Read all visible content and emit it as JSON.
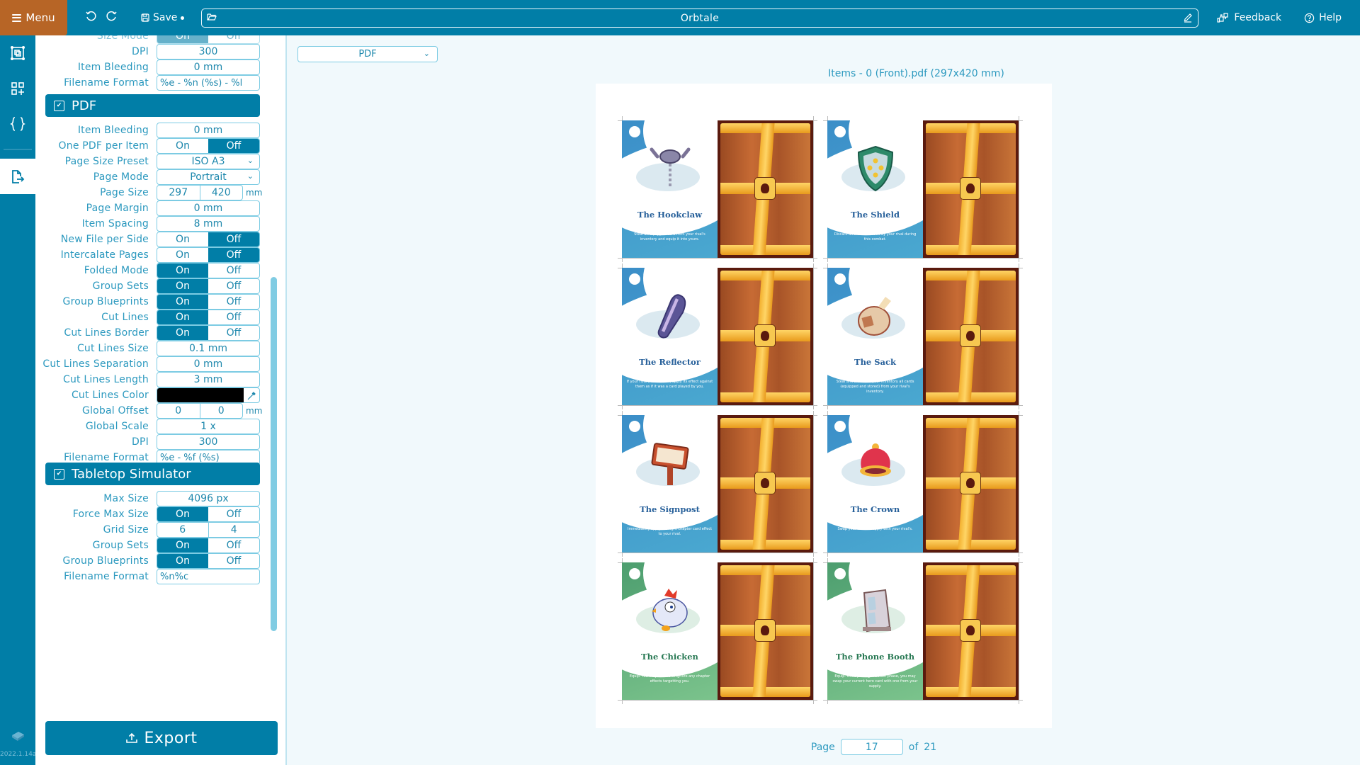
{
  "topbar": {
    "menu_label": "Menu",
    "save_label": "Save",
    "project_title": "Orbtale",
    "feedback_label": "Feedback",
    "help_label": "Help"
  },
  "rail": {
    "items": [
      {
        "name": "layout",
        "icon": "frame-icon"
      },
      {
        "name": "components",
        "icon": "add-grid-icon"
      },
      {
        "name": "code",
        "icon": "braces-icon"
      },
      {
        "name": "export",
        "icon": "file-export-icon",
        "active": true
      }
    ],
    "version": "2022.1.14a"
  },
  "image_section": {
    "partial_row_label": "Size Mode",
    "dpi_label": "DPI",
    "dpi": "300",
    "item_bleeding_label": "Item Bleeding",
    "item_bleeding": "0 mm",
    "filename_format_label": "Filename Format",
    "filename_format": "%e - %n (%s) - %l"
  },
  "pdf_section": {
    "title": "PDF",
    "enabled": true,
    "item_bleeding_label": "Item Bleeding",
    "item_bleeding": "0 mm",
    "one_pdf_label": "One PDF per Item",
    "page_size_preset_label": "Page Size Preset",
    "page_size_preset": "ISO A3",
    "page_mode_label": "Page Mode",
    "page_mode": "Portrait",
    "page_size_label": "Page Size",
    "page_width": "297",
    "page_height": "420",
    "page_size_unit": "mm",
    "page_margin_label": "Page Margin",
    "page_margin": "0 mm",
    "item_spacing_label": "Item Spacing",
    "item_spacing": "8 mm",
    "new_file_label": "New File per Side",
    "intercalate_label": "Intercalate Pages",
    "folded_label": "Folded Mode",
    "group_sets_label": "Group Sets",
    "group_blueprints_label": "Group Blueprints",
    "cut_lines_label": "Cut Lines",
    "cut_lines_border_label": "Cut Lines Border",
    "cut_lines_size_label": "Cut Lines Size",
    "cut_lines_size": "0.1 mm",
    "cut_lines_sep_label": "Cut Lines Separation",
    "cut_lines_sep": "0 mm",
    "cut_lines_length_label": "Cut Lines Length",
    "cut_lines_length": "3 mm",
    "cut_lines_color_label": "Cut Lines Color",
    "cut_lines_color": "#000000",
    "global_offset_label": "Global Offset",
    "offset_x": "0",
    "offset_y": "0",
    "offset_unit": "mm",
    "global_scale_label": "Global Scale",
    "global_scale": "1 x",
    "dpi_label": "DPI",
    "dpi": "300",
    "filename_format_label": "Filename Format",
    "filename_format": "%e - %f (%s)"
  },
  "toggles": {
    "on": "On",
    "off": "Off",
    "size_mode": "on",
    "one_pdf": "off",
    "new_file": "off",
    "intercalate": "off",
    "folded": "on",
    "group_sets": "on",
    "group_blueprints": "on",
    "cut_lines": "on",
    "cut_lines_border": "on",
    "tts_force_max": "on",
    "tts_group_sets": "on",
    "tts_group_blueprints": "on"
  },
  "tts_section": {
    "title": "Tabletop Simulator",
    "enabled": true,
    "max_size_label": "Max Size",
    "max_size": "4096 px",
    "force_max_label": "Force Max Size",
    "grid_size_label": "Grid Size",
    "grid_cols": "6",
    "grid_rows": "4",
    "group_sets_label": "Group Sets",
    "group_blueprints_label": "Group Blueprints",
    "filename_format_label": "Filename Format",
    "filename_format": "%n%c"
  },
  "export_label": "Export",
  "preview": {
    "format": "PDF",
    "document_title": "Items - 0 (Front).pdf (297x420 mm)",
    "page_label": "Page",
    "page_current": "17",
    "of_label": "of",
    "page_total": "21",
    "cards": [
      {
        "name": "The Hookclaw",
        "desc": "Steal an equipped card from your rival's inventory and equip it into yours.",
        "theme": "blue",
        "art": "hook-claw"
      },
      {
        "name": "The Shield",
        "desc": "Discard all the cards used by your rival during this combat.",
        "theme": "blue",
        "art": "shield"
      },
      {
        "name": "The Reflector",
        "desc": "If your rival's card is a ✎, apply its effect against them as if it was a card played by you.",
        "theme": "blue",
        "art": "mirror"
      },
      {
        "name": "The Sack",
        "desc": "Steal and store into your inventory all cards (equipped and stored) from your rival's inventory.",
        "theme": "blue",
        "art": "sack"
      },
      {
        "name": "The Signpost",
        "desc": "Immediately apply the right chapter card effect to your rival.",
        "theme": "blue",
        "art": "signpost"
      },
      {
        "name": "The Crown",
        "desc": "Swap your heroes supply with your rival's.",
        "theme": "blue",
        "art": "crown"
      },
      {
        "name": "The Chicken",
        "desc": "Equip. You may choose to ignore any chapter effects targetting you.",
        "theme": "green",
        "art": "chicken"
      },
      {
        "name": "The Phone Booth",
        "desc": "Equip. Once per organization phase, you may swap your current hero card with one from your supply.",
        "theme": "green",
        "art": "phone-booth"
      }
    ]
  }
}
